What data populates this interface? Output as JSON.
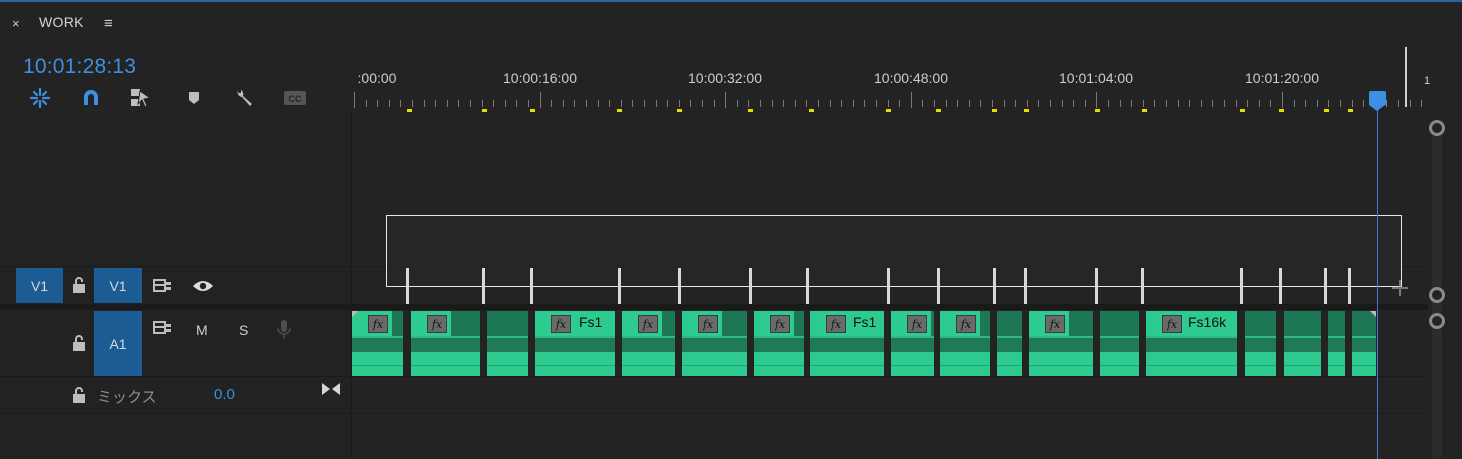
{
  "panel": {
    "close_label": "×",
    "title": "WORK",
    "menu_label": "≡"
  },
  "timecode": "10:01:28:13",
  "toolbar": {
    "tools": [
      "snap-nested-icon",
      "magnet-icon",
      "linked-selection-icon",
      "add-marker-icon",
      "wrench-icon",
      "captions-icon"
    ]
  },
  "ruler": {
    "labels": [
      ":00:00",
      "10:00:16:00",
      "10:00:32:00",
      "10:00:48:00",
      "10:01:04:00",
      "10:01:20:00"
    ],
    "end_label": "1",
    "marker_color": "#e3e000"
  },
  "tracks": {
    "v1": {
      "source_label": "V1",
      "target_label": "V1"
    },
    "a1": {
      "target_label": "A1",
      "mute_label": "M",
      "solo_label": "S"
    },
    "mix": {
      "label": "ミックス",
      "value": "0.0"
    }
  },
  "clips": {
    "labels": [
      "Fs1",
      "Fs1",
      "Fs16k"
    ],
    "fx_label": "fx",
    "color": "#2ecb91"
  },
  "colors": {
    "accent": "#3d8fe2",
    "track_button": "#1b5c95",
    "clip": "#2ecb91"
  }
}
